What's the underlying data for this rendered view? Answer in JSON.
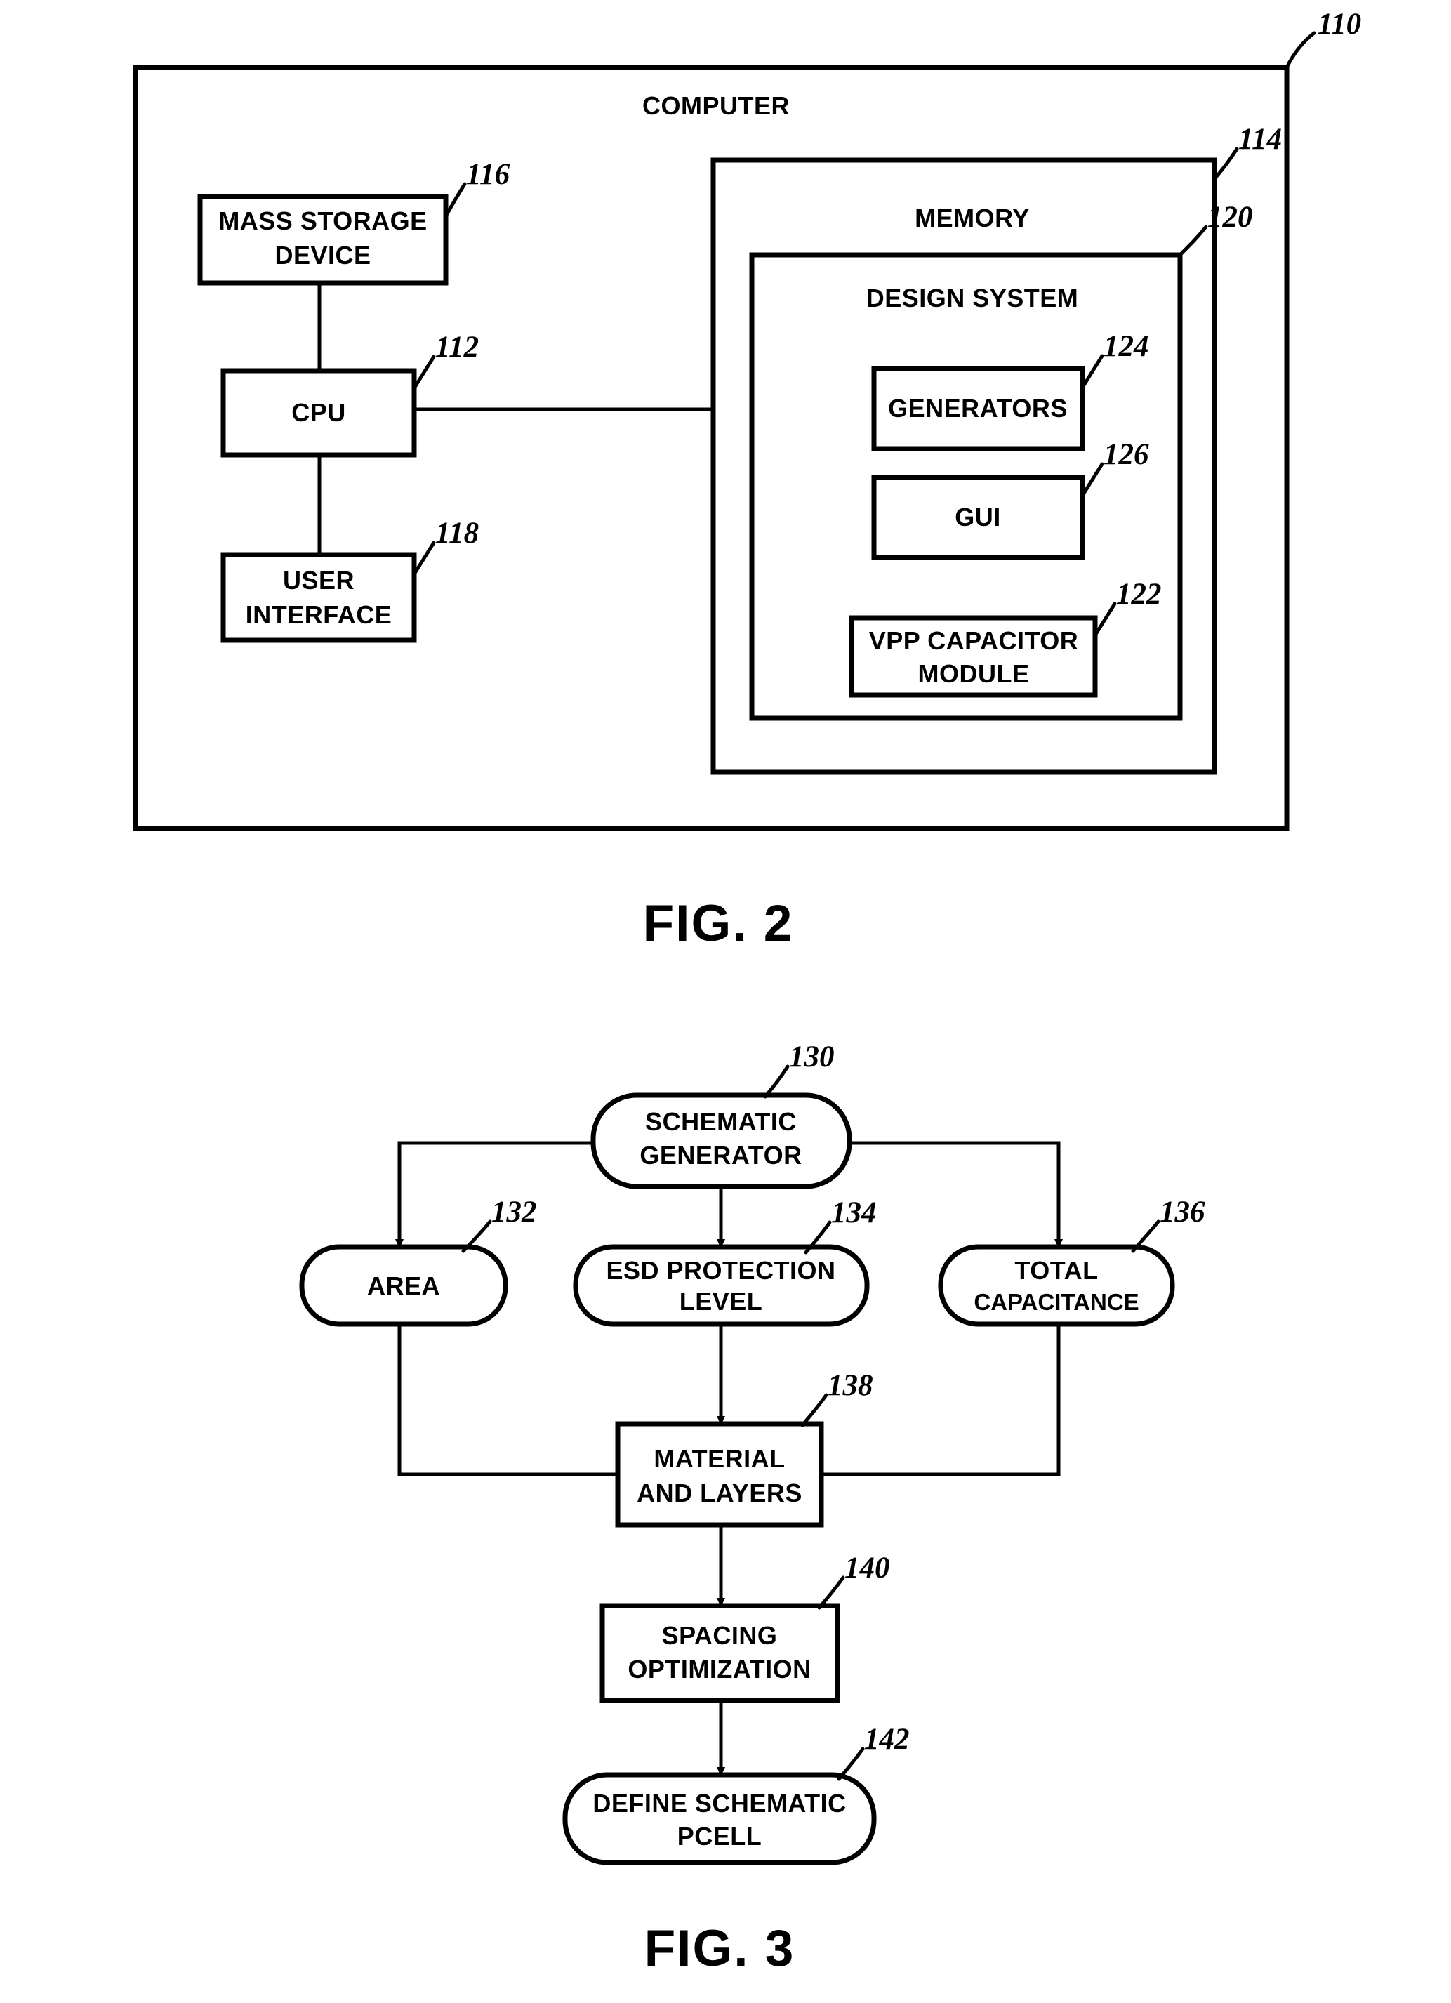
{
  "figures": [
    {
      "caption": "FIG. 2",
      "outer_label": "COMPUTER",
      "outer_ref": "110",
      "blocks": [
        {
          "id": "mass-storage-device",
          "label_line1": "MASS STORAGE",
          "label_line2": "DEVICE",
          "ref": "116"
        },
        {
          "id": "cpu",
          "label_line1": "CPU",
          "label_line2": "",
          "ref": "112"
        },
        {
          "id": "user-interface",
          "label_line1": "USER",
          "label_line2": "INTERFACE",
          "ref": "118"
        },
        {
          "id": "memory",
          "label_line1": "MEMORY",
          "label_line2": "",
          "ref": "114"
        },
        {
          "id": "design-system",
          "label_line1": "DESIGN SYSTEM",
          "label_line2": "",
          "ref": "120"
        },
        {
          "id": "generators",
          "label_line1": "GENERATORS",
          "label_line2": "",
          "ref": "124"
        },
        {
          "id": "gui",
          "label_line1": "GUI",
          "label_line2": "",
          "ref": "126"
        },
        {
          "id": "vpp-capacitor-module",
          "label_line1": "VPP CAPACITOR",
          "label_line2": "MODULE",
          "ref": "122"
        }
      ]
    },
    {
      "caption": "FIG. 3",
      "blocks": [
        {
          "id": "schematic-generator",
          "label_line1": "SCHEMATIC",
          "label_line2": "GENERATOR",
          "ref": "130",
          "shape": "stadium"
        },
        {
          "id": "area",
          "label_line1": "AREA",
          "label_line2": "",
          "ref": "132",
          "shape": "stadium"
        },
        {
          "id": "esd-protection-level",
          "label_line1": "ESD PROTECTION",
          "label_line2": "LEVEL",
          "ref": "134",
          "shape": "stadium"
        },
        {
          "id": "total-capacitance",
          "label_line1": "TOTAL",
          "label_line2": "CAPACITANCE",
          "ref": "136",
          "shape": "stadium"
        },
        {
          "id": "material-and-layers",
          "label_line1": "MATERIAL",
          "label_line2": "AND LAYERS",
          "ref": "138",
          "shape": "rect"
        },
        {
          "id": "spacing-optimization",
          "label_line1": "SPACING",
          "label_line2": "OPTIMIZATION",
          "ref": "140",
          "shape": "rect"
        },
        {
          "id": "define-schematic-pcell",
          "label_line1": "DEFINE SCHEMATIC",
          "label_line2": "PCELL",
          "ref": "142",
          "shape": "stadium"
        }
      ]
    }
  ],
  "colors": {
    "ink": "#000000",
    "paper": "#ffffff"
  }
}
